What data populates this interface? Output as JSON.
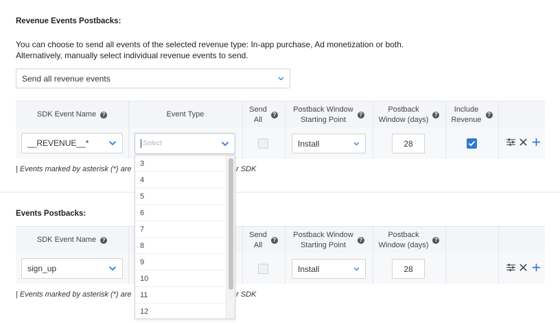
{
  "revenue_section": {
    "title": "Revenue Events Postbacks:",
    "desc_line1": "You can choose to send all events of the selected revenue type: In-app purchase, Ad monetization or both.",
    "desc_line2": "Alternatively, manually select individual revenue events to send.",
    "send_mode": "Send all revenue events",
    "headers": {
      "sdk_event_name": "SDK Event Name",
      "event_type": "Event Type",
      "send_all_1": "Send",
      "send_all_2": "All",
      "window_start_1": "Postback Window",
      "window_start_2": "Starting Point",
      "window_days_1": "Postback",
      "window_days_2": "Window (days)",
      "include_revenue_1": "Include",
      "include_revenue_2": "Revenue",
      "help": "?"
    },
    "row": {
      "sdk_event": "__REVENUE__*",
      "event_type_placeholder": "Select",
      "starting_point": "Install",
      "window_days": "28"
    },
    "note_left": "| Events marked by asterisk (*) are",
    "note_right": "r SDK"
  },
  "events_section": {
    "title": "Events Postbacks:",
    "headers": {
      "sdk_event_name": "SDK Event Name",
      "send_all_1": "Send",
      "send_all_2": "All",
      "window_start_1": "Postback Window",
      "window_start_2": "Starting Point",
      "window_days_1": "Postback",
      "window_days_2": "Window (days)",
      "help": "?"
    },
    "row": {
      "sdk_event": "sign_up",
      "starting_point": "Install",
      "window_days": "28"
    },
    "note_left": "| Events marked by asterisk (*) are",
    "note_right": "r SDK"
  },
  "dropdown_options": [
    "3",
    "4",
    "5",
    "6",
    "7",
    "8",
    "9",
    "10",
    "11",
    "12"
  ],
  "colors": {
    "accent": "#2a7bd4",
    "header_bg": "#f3f5f8",
    "row_bg": "#f7f8fa"
  }
}
